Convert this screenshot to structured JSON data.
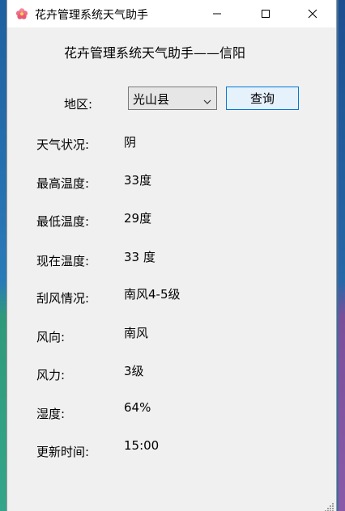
{
  "window": {
    "title": "花卉管理系统天气助手"
  },
  "heading": "花卉管理系统天气助手——信阳",
  "region": {
    "label": "地区:",
    "selected": "光山县",
    "query_button": "查询"
  },
  "fields": [
    {
      "label": "天气状况:",
      "value": "阴"
    },
    {
      "label": "最高温度:",
      "value": "33度"
    },
    {
      "label": "最低温度:",
      "value": "29度"
    },
    {
      "label": "现在温度:",
      "value": "33 度"
    },
    {
      "label": "刮风情况:",
      "value": "南风4-5级"
    },
    {
      "label": "风向:",
      "value": "南风"
    },
    {
      "label": "风力:",
      "value": "3级"
    },
    {
      "label": "湿度:",
      "value": "64%"
    },
    {
      "label": "更新时间:",
      "value": "15:00"
    }
  ],
  "icons": {
    "app": "flower-icon",
    "minimize": "minimize-icon",
    "maximize": "maximize-icon",
    "close": "close-icon",
    "dropdown": "chevron-down-icon",
    "grip": "resize-grip-icon"
  }
}
